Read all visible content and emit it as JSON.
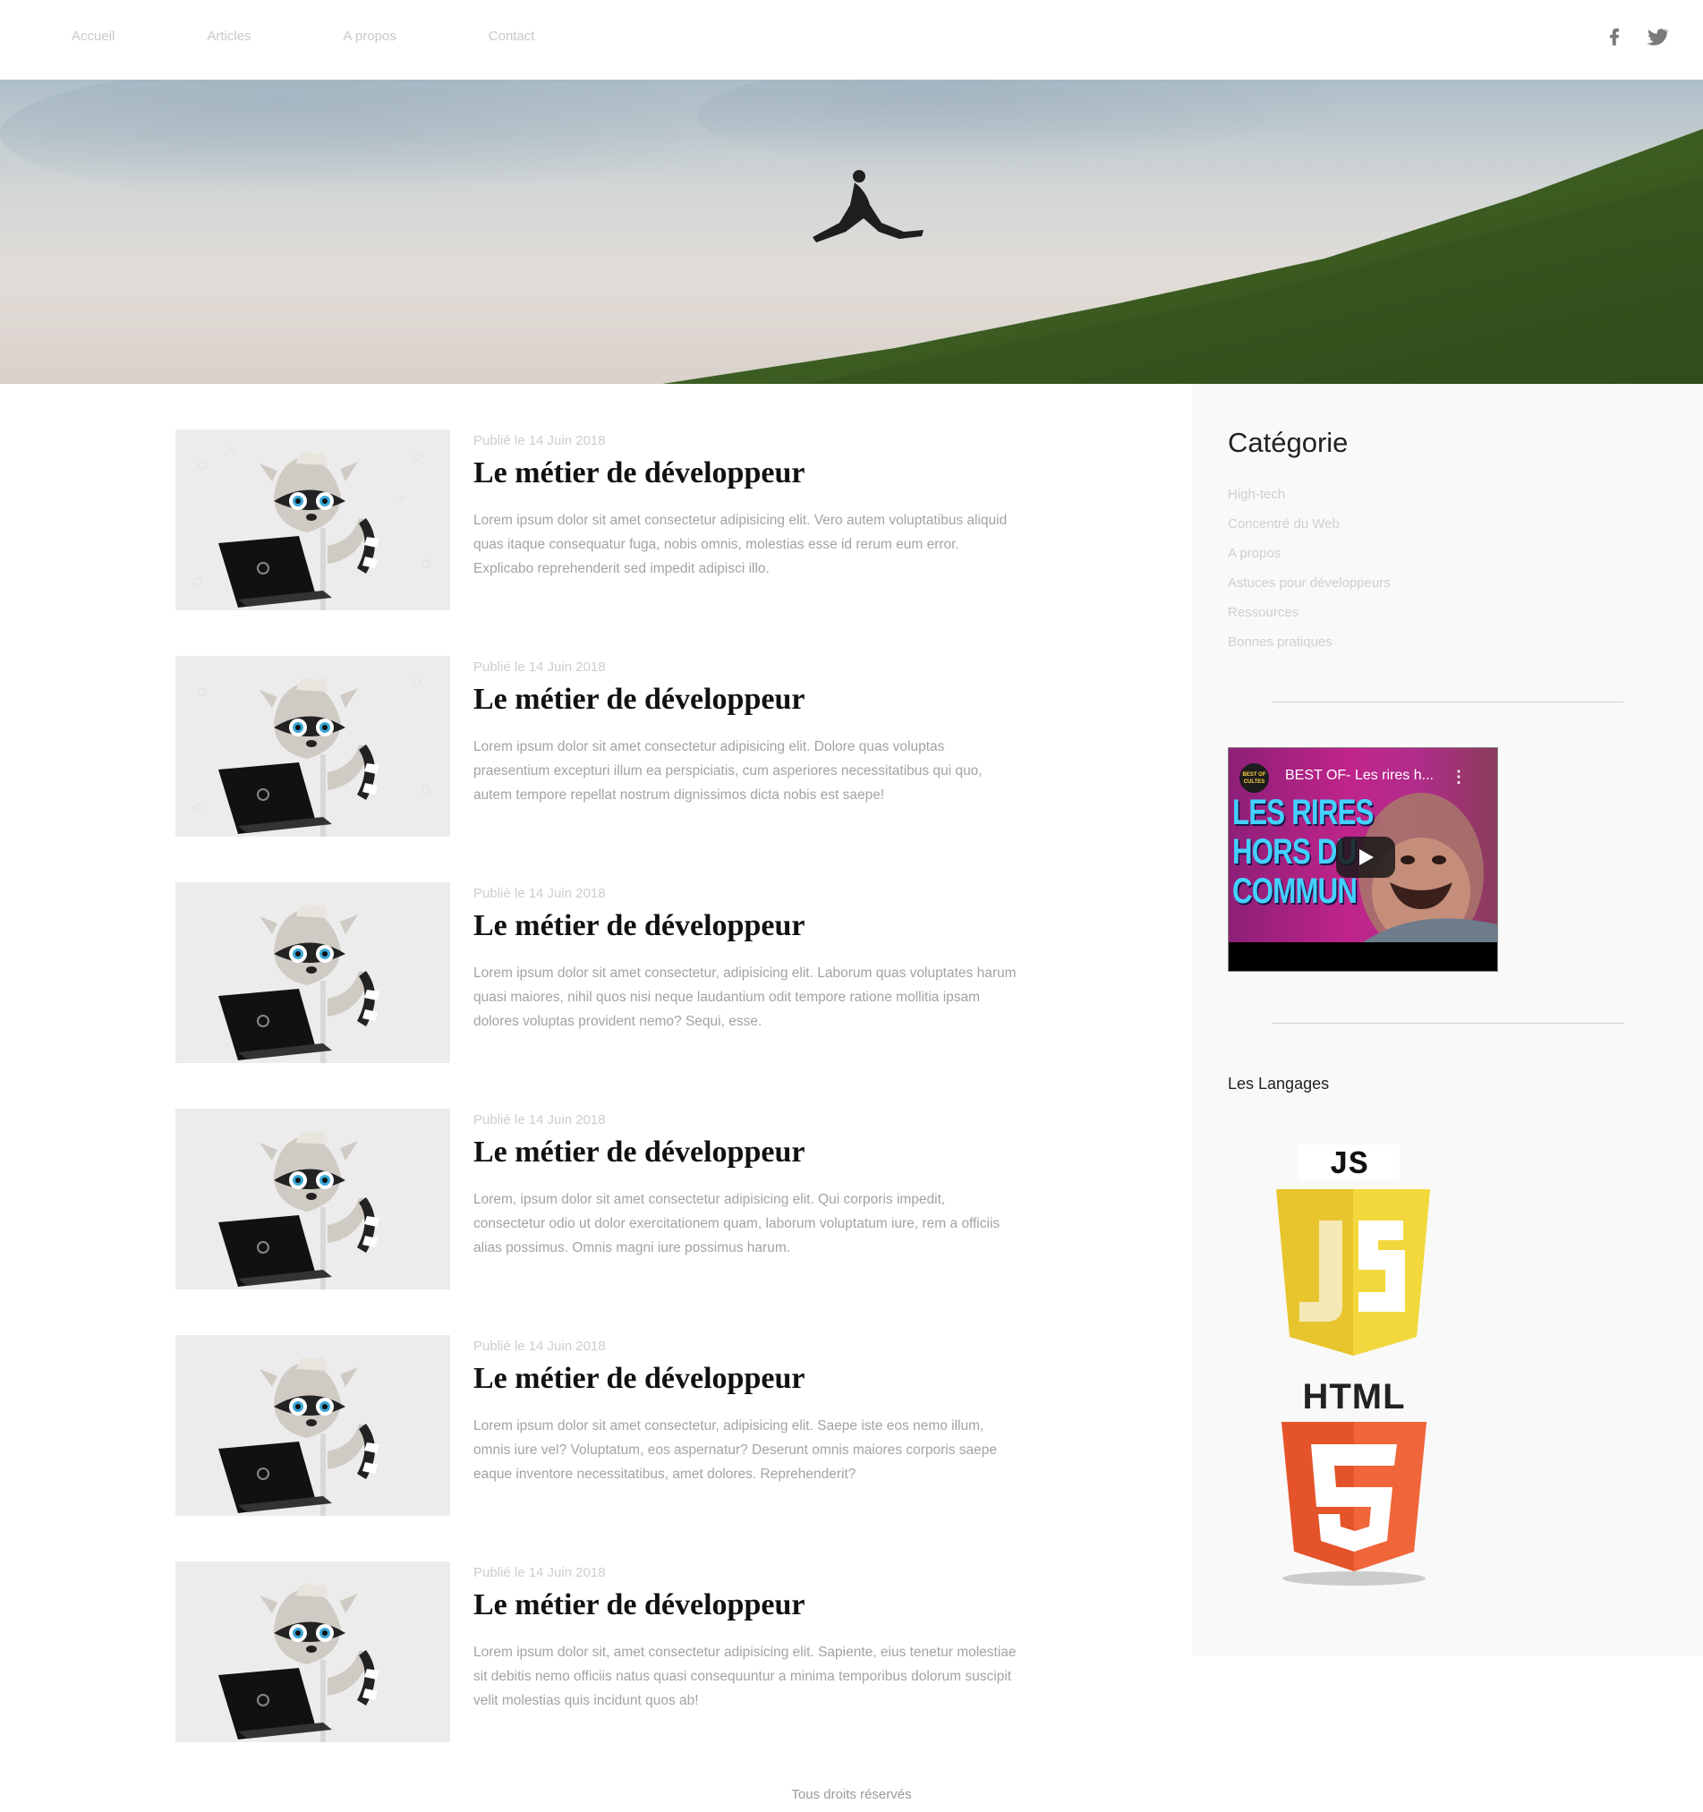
{
  "nav": {
    "items": [
      "Accueil",
      "Articles",
      "A propos",
      "Contact"
    ]
  },
  "social": {
    "icons": [
      "facebook-icon",
      "twitter-icon"
    ]
  },
  "posts": [
    {
      "date": "Publié le 14 Juin 2018",
      "title": "Le métier de développeur",
      "excerpt": "Lorem ipsum dolor sit amet consectetur adipisicing elit. Vero autem voluptatibus aliquid quas itaque consequatur fuga, nobis omnis, molestias esse id rerum eum error. Explicabo reprehenderit sed impedit adipisci illo."
    },
    {
      "date": "Publié le 14 Juin 2018",
      "title": "Le métier de développeur",
      "excerpt": "Lorem ipsum dolor sit amet consectetur adipisicing elit. Dolore quas voluptas praesentium excepturi illum ea perspiciatis, cum asperiores necessitatibus qui quo, autem tempore repellat nostrum dignissimos dicta nobis est saepe!"
    },
    {
      "date": "Publié le 14 Juin 2018",
      "title": "Le métier de développeur",
      "excerpt": "Lorem ipsum dolor sit amet consectetur, adipisicing elit. Laborum quas voluptates harum quasi maiores, nihil quos nisi neque laudantium odit tempore ratione mollitia ipsam dolores voluptas provident nemo? Sequi, esse."
    },
    {
      "date": "Publié le 14 Juin 2018",
      "title": "Le métier de développeur",
      "excerpt": "Lorem, ipsum dolor sit amet consectetur adipisicing elit. Qui corporis impedit, consectetur odio ut dolor exercitationem quam, laborum voluptatum iure, rem a officiis alias possimus. Omnis magni iure possimus harum."
    },
    {
      "date": "Publié le 14 Juin 2018",
      "title": "Le métier de développeur",
      "excerpt": "Lorem ipsum dolor sit amet consectetur, adipisicing elit. Saepe iste eos nemo illum, omnis iure vel? Voluptatum, eos aspernatur? Deserunt omnis maiores corporis saepe eaque inventore necessitatibus, amet dolores. Reprehenderit?"
    },
    {
      "date": "Publié le 14 Juin 2018",
      "title": "Le métier de développeur",
      "excerpt": "Lorem ipsum dolor sit, amet consectetur adipisicing elit. Sapiente, eius tenetur molestiae sit debitis nemo officiis natus quasi consequuntur a minima temporibus dolorum suscipit velit molestias quis incidunt quos ab!"
    }
  ],
  "sidebar": {
    "category_title": "Catégorie",
    "categories": [
      "High-tech",
      "Concentré du Web",
      "A propos",
      "Astuces pour développeurs",
      "Ressources",
      "Bonnes pratiques"
    ],
    "video": {
      "channel_badge": "BEST OF CULTES",
      "title": "BEST OF- Les rires h...",
      "menu_icon": "⋮",
      "overlay_lines": [
        "LES RIRES",
        "HORS DU",
        "COMMUN"
      ]
    },
    "languages_title": "Les Langages",
    "logos": {
      "js_label": "JS",
      "html_label": "HTML"
    }
  },
  "footer": {
    "text": "Tous droits réservés"
  },
  "colors": {
    "nav_text": "#c9c9c9",
    "meta_text": "#cdcdcd",
    "excerpt_text": "#a3a3a3",
    "sidebar_bg": "#f9f9f9",
    "js_yellow": "#e8c52d",
    "html_orange": "#e4532a"
  }
}
